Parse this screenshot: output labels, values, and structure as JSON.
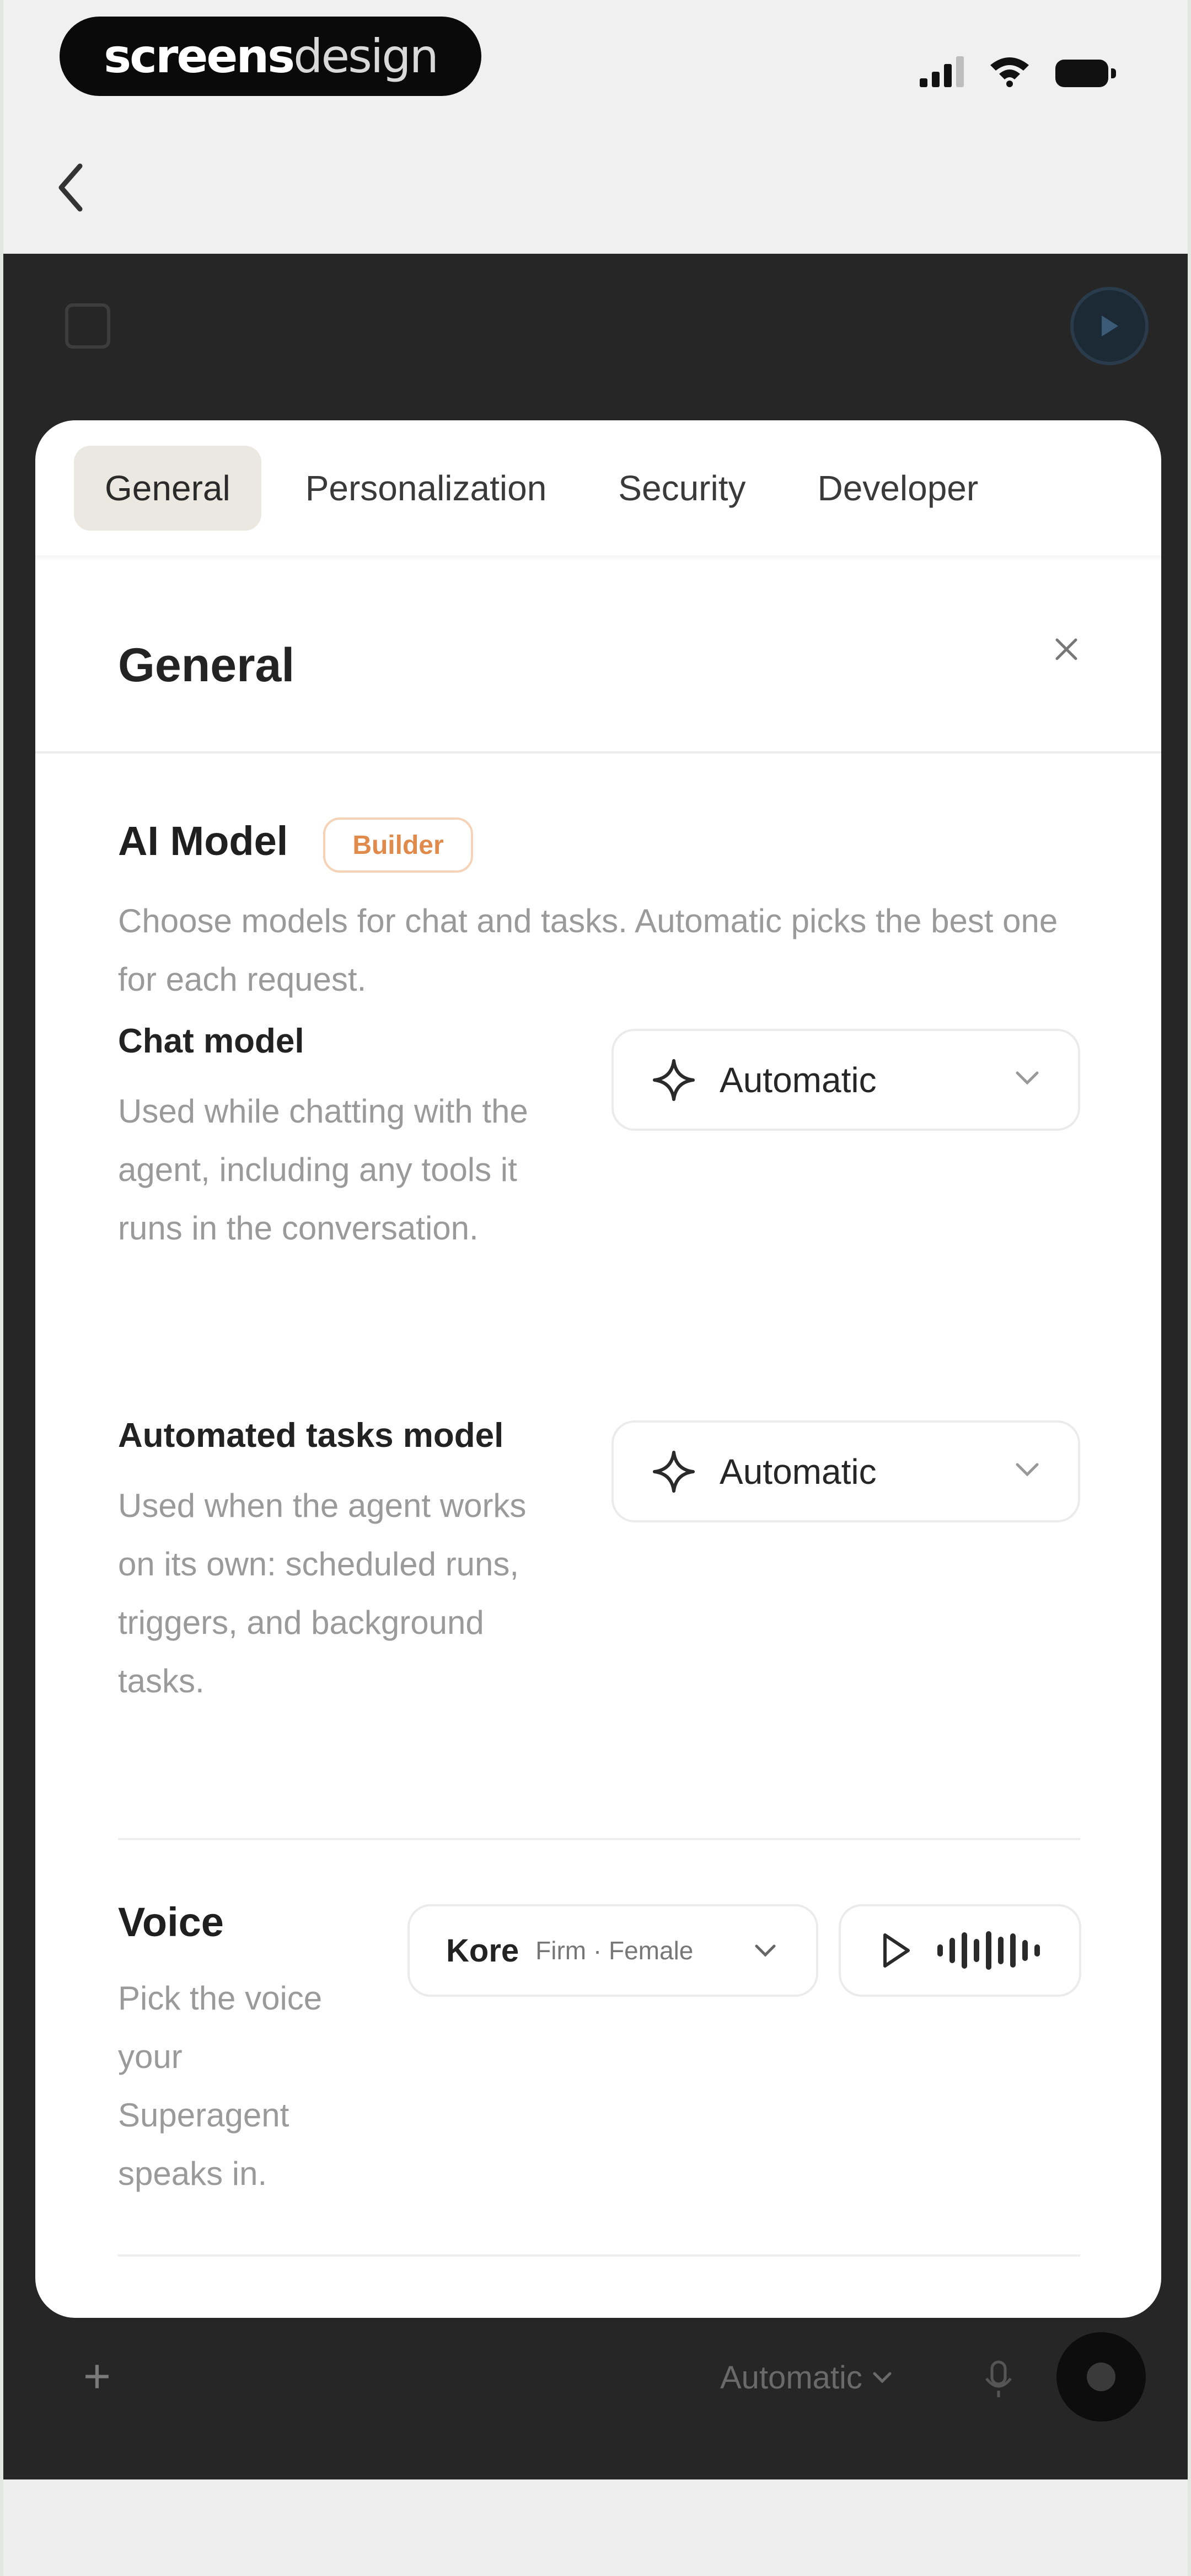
{
  "status_bar": {
    "logo_bold": "screens",
    "logo_light": "design"
  },
  "composer": {
    "model_label": "Automatic"
  },
  "modal": {
    "tabs": [
      {
        "label": "General",
        "active": true
      },
      {
        "label": "Personalization",
        "active": false
      },
      {
        "label": "Security",
        "active": false
      },
      {
        "label": "Developer",
        "active": false
      }
    ],
    "title": "General",
    "ai_model": {
      "heading": "AI Model",
      "badge": "Builder",
      "description": "Choose models for chat and tasks. Automatic picks the best one for each request.",
      "chat": {
        "label": "Chat model",
        "description": "Used while chatting with the agent, including any tools it runs in the conversation.",
        "value": "Automatic"
      },
      "tasks": {
        "label": "Automated tasks model",
        "description": "Used when the agent works on its own: scheduled runs, triggers, and background tasks.",
        "value": "Automatic"
      }
    },
    "voice": {
      "heading": "Voice",
      "description": "Pick the voice your Superagent speaks in.",
      "selected_name": "Kore",
      "selected_meta": "Firm · Female"
    }
  },
  "icons": {
    "back": "chevron-left-icon",
    "close": "close-icon",
    "sparkle": "sparkle-icon",
    "play": "play-icon",
    "waveform": "waveform-icon"
  },
  "colors": {
    "overlay_bg": "#262626",
    "badge_orange": "#e08a4c",
    "tab_active_bg": "#ebe8e1"
  }
}
